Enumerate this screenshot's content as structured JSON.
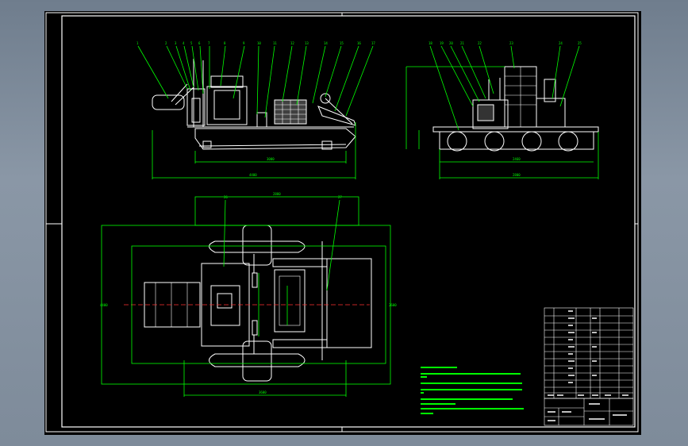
{
  "drawing": {
    "side_view_balloons": [
      "1",
      "2",
      "3",
      "4",
      "5",
      "6",
      "7",
      "8",
      "9",
      "10",
      "11",
      "12",
      "13",
      "14",
      "15",
      "16",
      "17"
    ],
    "end_view_balloons": [
      "18",
      "19",
      "20",
      "21",
      "22",
      "23",
      "24",
      "25"
    ],
    "plan_view_balloons": [
      "26",
      "27"
    ],
    "note_lines": 7,
    "parts_list_rows": 12,
    "title_block_cells": 6
  },
  "colors": {
    "background": "#000000",
    "frame": "#ffffff",
    "outline": "#ffffff",
    "dimension": "#00ff00",
    "leader": "#00ff00",
    "centerline": "#ff3030",
    "hatch": "#ffffff"
  }
}
